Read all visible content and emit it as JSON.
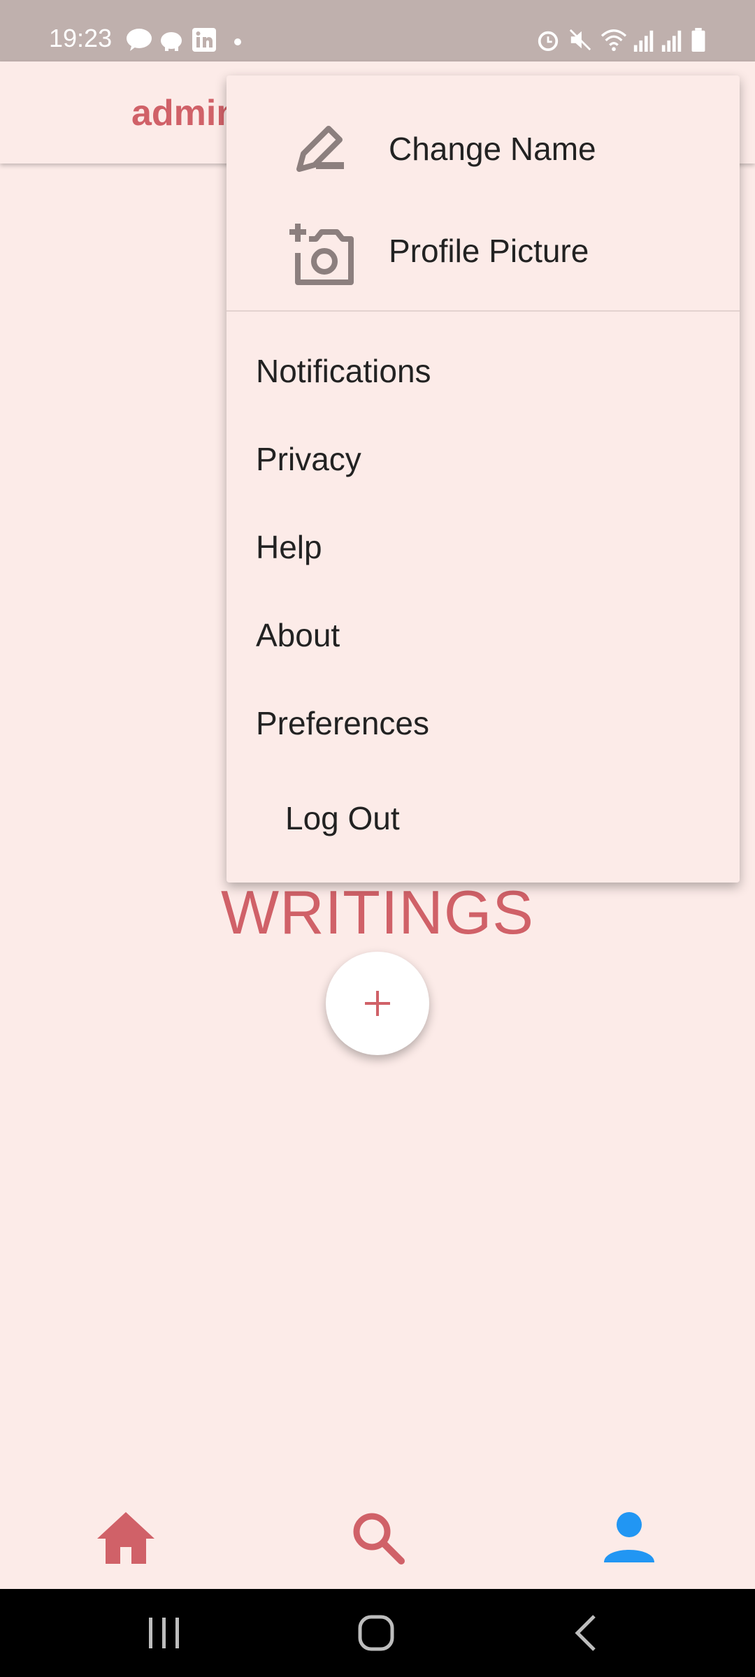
{
  "status_bar": {
    "time": "19:23",
    "left_icons": [
      "talk-icon",
      "piggy-bank-icon",
      "linkedin-icon",
      "dot-icon"
    ],
    "right_icons": [
      "alarm-icon",
      "mute-icon",
      "wifi-icon",
      "signal-icon",
      "signal-icon",
      "battery-icon"
    ]
  },
  "app_bar": {
    "title": "admin"
  },
  "main": {
    "heading": "WRITINGS",
    "fab_icon": "plus-icon"
  },
  "menu": {
    "profile_items": [
      {
        "label": "Change Name",
        "icon": "edit-icon"
      },
      {
        "label": "Profile Picture",
        "icon": "add-photo-icon"
      }
    ],
    "items": [
      "Notifications",
      "Privacy",
      "Help",
      "About",
      "Preferences"
    ],
    "logout": "Log Out"
  },
  "bottom_nav": {
    "items": [
      {
        "icon": "home-icon",
        "active": false
      },
      {
        "icon": "search-icon",
        "active": false
      },
      {
        "icon": "person-icon",
        "active": true
      }
    ]
  },
  "colors": {
    "accent": "#d06168",
    "active": "#2196f3",
    "background": "#fcebe8",
    "icon_gray": "#8c7f7e"
  }
}
